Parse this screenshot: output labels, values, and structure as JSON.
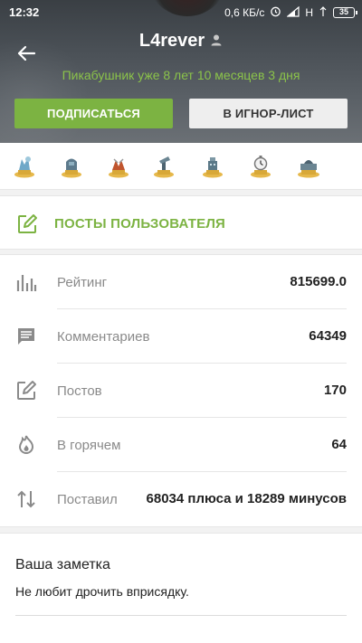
{
  "status_bar": {
    "time": "12:32",
    "speed": "0,6 КБ/с",
    "network": "H",
    "battery": "35"
  },
  "profile": {
    "username": "L4rever",
    "since": "Пикабушник уже 8 лет 10 месяцев 3 дня",
    "subscribe_label": "ПОДПИСАТЬСЯ",
    "ignore_label": "В ИГНОР-ЛИСТ"
  },
  "awards": [
    "award-icon-1",
    "award-icon-2",
    "award-icon-3",
    "award-icon-4",
    "award-icon-5",
    "award-icon-6",
    "award-icon-7"
  ],
  "posts_link": {
    "label": "ПОСТЫ ПОЛЬЗОВАТЕЛЯ"
  },
  "stats": [
    {
      "label": "Рейтинг",
      "value": "815699.0"
    },
    {
      "label": "Комментариев",
      "value": "64349"
    },
    {
      "label": "Постов",
      "value": "170"
    },
    {
      "label": "В горячем",
      "value": "64"
    },
    {
      "label": "Поставил",
      "value": "68034 плюса и 18289 минусов"
    }
  ],
  "note": {
    "title": "Ваша заметка",
    "text": "Не любит дрочить вприсядку."
  },
  "colors": {
    "accent": "#7cb342",
    "since_text": "#8bc34a",
    "header_bg": "#4a5056"
  }
}
